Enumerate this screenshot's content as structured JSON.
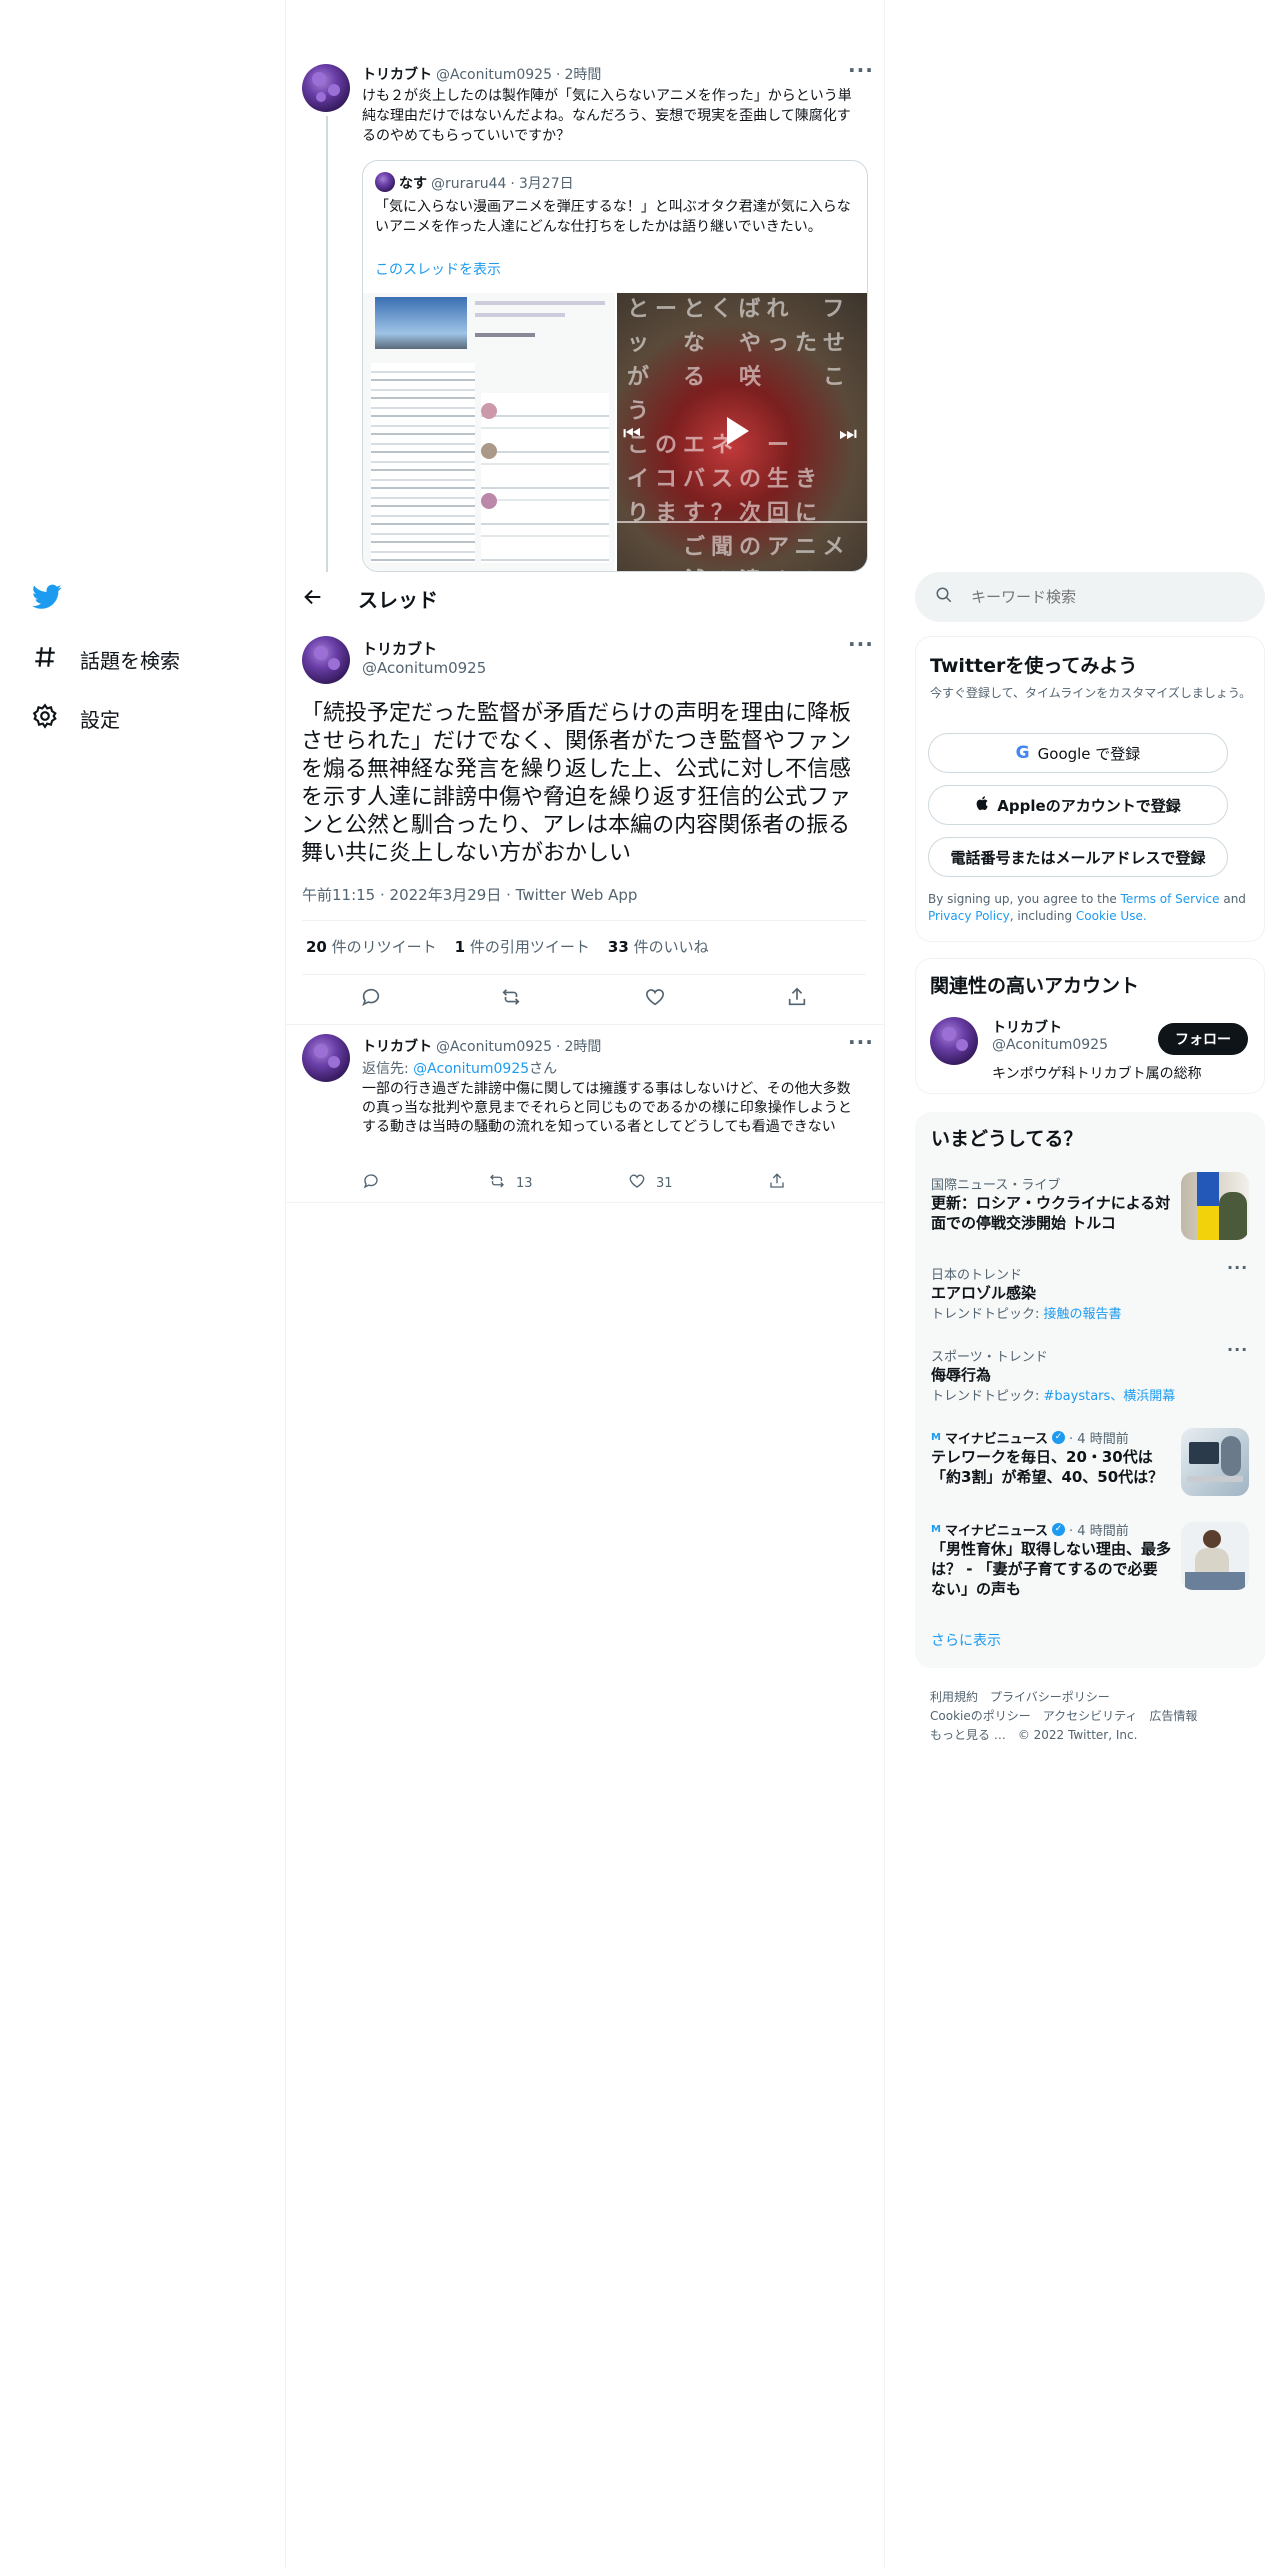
{
  "nav": {
    "explore_label": "話題を検索",
    "settings_label": "設定"
  },
  "thread_header": {
    "title": "スレッド"
  },
  "search": {
    "placeholder": "キーワード検索"
  },
  "context_tweet": {
    "name": "トリカブト",
    "handle": "@Aconitum0925",
    "time": "2時間",
    "text": "けも２が炎上したのは製作陣が「気に入らないアニメを作った」からという単純な理由だけではないんだよね。なんだろう、妄想で現実を歪曲して陳腐化するのやめてもらっていいですか？",
    "quote": {
      "name": "なす",
      "handle": "@ruraru44",
      "date": "3月27日",
      "text": "「気に入らない漫画アニメを弾圧するな！」と叫ぶオタク君達が気に入らないアニメを作った人達にどんな仕打ちをしたかは語り継いでいきたい。",
      "show_thread": "このスレッドを表示"
    }
  },
  "main_tweet": {
    "name": "トリカブト",
    "handle": "@Aconitum0925",
    "text": "「続投予定だった監督が矛盾だらけの声明を理由に降板させられた」だけでなく、関係者がたつき監督やファンを煽る無神経な発言を繰り返した上、公式に対し不信感を示す人達に誹謗中傷や脅迫を繰り返す狂信的公式ファンと公然と馴合ったり、アレは本編の内容関係者の振る舞い共に炎上しない方がおかしい",
    "timestamp": "午前11:15 · 2022年3月29日 · Twitter Web App",
    "stats": {
      "retweets_num": "20",
      "retweets_label": "件のリツイート",
      "quotes_num": "1",
      "quotes_label": "件の引用ツイート",
      "likes_num": "33",
      "likes_label": "件のいいね"
    }
  },
  "reply_tweet": {
    "name": "トリカブト",
    "handle": "@Aconitum0925",
    "time": "2時間",
    "reply_to_prefix": "返信先: ",
    "reply_to_handle": "@Aconitum0925",
    "reply_to_suffix": "さん",
    "text": "一部の行き過ぎた誹謗中傷に関しては擁護する事はしないけど、その他大多数の真っ当な批判や意見までそれらと同じものであるかの様に印象操作しようとする動きは当時の騒動の流れを知っている者としてどうしても看過できない",
    "retweets": "13",
    "likes": "31"
  },
  "signup": {
    "title": "Twitterを使ってみよう",
    "subtitle": "今すぐ登録して、タイムラインをカスタマイズしましょう。",
    "google": "Google で登録",
    "apple": "Appleのアカウントで登録",
    "phone": "電話番号またはメールアドレスで登録",
    "terms_1": "By signing up, you agree to the ",
    "terms_link1": "Terms of Service",
    "terms_2": " and ",
    "terms_link2": "Privacy Policy",
    "terms_3": ", including ",
    "terms_link3": "Cookie Use."
  },
  "related": {
    "title": "関連性の高いアカウント",
    "name": "トリカブト",
    "handle": "@Aconitum0925",
    "bio": "キンポウゲ科トリカブト属の総称",
    "follow": "フォロー"
  },
  "trends": {
    "title": "いまどうしてる？",
    "items": [
      {
        "meta": "国際ニュース・ライブ",
        "title": "更新：ロシア・ウクライナによる対面での停戦交渉開始 トルコ"
      },
      {
        "meta": "日本のトレンド",
        "title": "エアロゾル感染",
        "topic_prefix": "トレンドトピック: ",
        "topic": "接触の報告書"
      },
      {
        "meta": "スポーツ・トレンド",
        "title": "侮辱行為",
        "topic_prefix": "トレンドトピック: ",
        "topic": "#baystars、横浜開幕"
      },
      {
        "source": "マイナビニュース",
        "time": "· 4 時間前",
        "title": "テレワークを毎日、20・30代は「約3割」が希望、40、50代は？"
      },
      {
        "source": "マイナビニュース",
        "time": "· 4 時間前",
        "title": "「男性育休」取得しない理由、最多は？ - 「妻が子育てするので必要ない」の声も"
      }
    ],
    "show_more": "さらに表示"
  },
  "footer": {
    "terms": "利用規約",
    "privacy": "プライバシーポリシー",
    "cookie": "Cookieのポリシー",
    "accessibility": "アクセシビリティ",
    "ads": "広告情報",
    "more": "もっと見る …",
    "copyright": "© 2022 Twitter, Inc."
  },
  "colors": {
    "accent": "#1d9bf0",
    "text": "#0f1419",
    "muted": "#536471",
    "border": "#eff3f4"
  }
}
